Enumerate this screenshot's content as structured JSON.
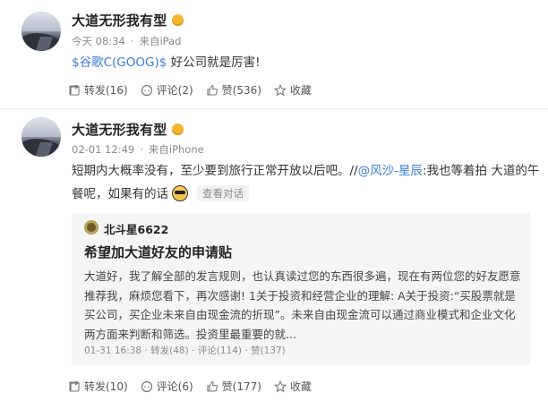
{
  "post1": {
    "author": "大道无形我有型",
    "time": "今天 08:34",
    "source": "来自iPad",
    "stock_link": "$谷歌C(GOOG)$",
    "text": " 好公司就是厉害!",
    "actions": {
      "repost": "转发(16)",
      "comment": "评论(2)",
      "like": "赞(536)",
      "favorite": "收藏"
    }
  },
  "post2": {
    "author": "大道无形我有型",
    "time": "02-01 12:49",
    "source": "来自iPhone",
    "text_line1": "短期内大概率没有，至少要到旅行正常开放以后吧。//",
    "mention": "@风沙-星辰",
    "text_line1_rest": ":我也等着拍 大道的午",
    "text_line2": "餐呢，如果有的话",
    "see_conversation": "查看对话",
    "quote": {
      "user": "北斗星6622",
      "title": "希望加大道好友的申请贴",
      "body": "大道好，我了解全部的发言规则，也认真读过您的东西很多遍，现在有两位您的好友愿意推荐我，麻烦您看下，再次感谢!  1关于投资和经营企业的理解:  A关于投资:“买股票就是买公司，买企业未来自由现金流的折现”。未来自由现金流可以通过商业模式和企业文化两方面来判断和筛选。投资里最重要的就...",
      "time": "01-31 16:38",
      "repost": "转发(48)",
      "comment": "评论(114)",
      "like": "赞(137)"
    },
    "actions": {
      "repost": "转发(10)",
      "comment": "评论(6)",
      "like": "赞(177)",
      "favorite": "收藏"
    }
  },
  "colors": {
    "link": "#3b7cd6",
    "vip_badge": "#f5b52e",
    "quote_bg": "#f5f5f5"
  }
}
